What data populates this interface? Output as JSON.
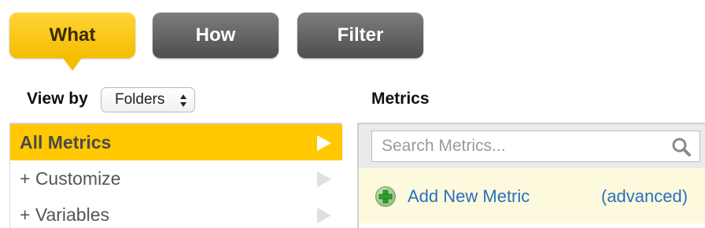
{
  "tabs": [
    {
      "label": "What",
      "state": "active"
    },
    {
      "label": "How",
      "state": "inactive"
    },
    {
      "label": "Filter",
      "state": "inactive"
    }
  ],
  "view_by": {
    "label": "View by",
    "selected_option": "Folders"
  },
  "left_list": {
    "items": [
      {
        "label": "All Metrics",
        "selected": true
      },
      {
        "label": "+ Customize",
        "selected": false
      },
      {
        "label": "+ Variables",
        "selected": false
      }
    ]
  },
  "metrics_panel": {
    "title": "Metrics",
    "search_placeholder": "Search Metrics...",
    "search_value": "",
    "add_new_label": "Add New Metric",
    "advanced_label": "(advanced)"
  },
  "icons": {
    "search": "search-icon",
    "add": "add-circle-icon",
    "arrow": "play-arrow-icon",
    "select_arrows": "up-down-arrows-icon"
  },
  "colors": {
    "accent_yellow": "#ffc800",
    "tab_dark": "#5a5a5a",
    "link_blue": "#2a6fc2",
    "add_row_bg": "#fcf9dd",
    "search_area_bg": "#eaeaea"
  }
}
